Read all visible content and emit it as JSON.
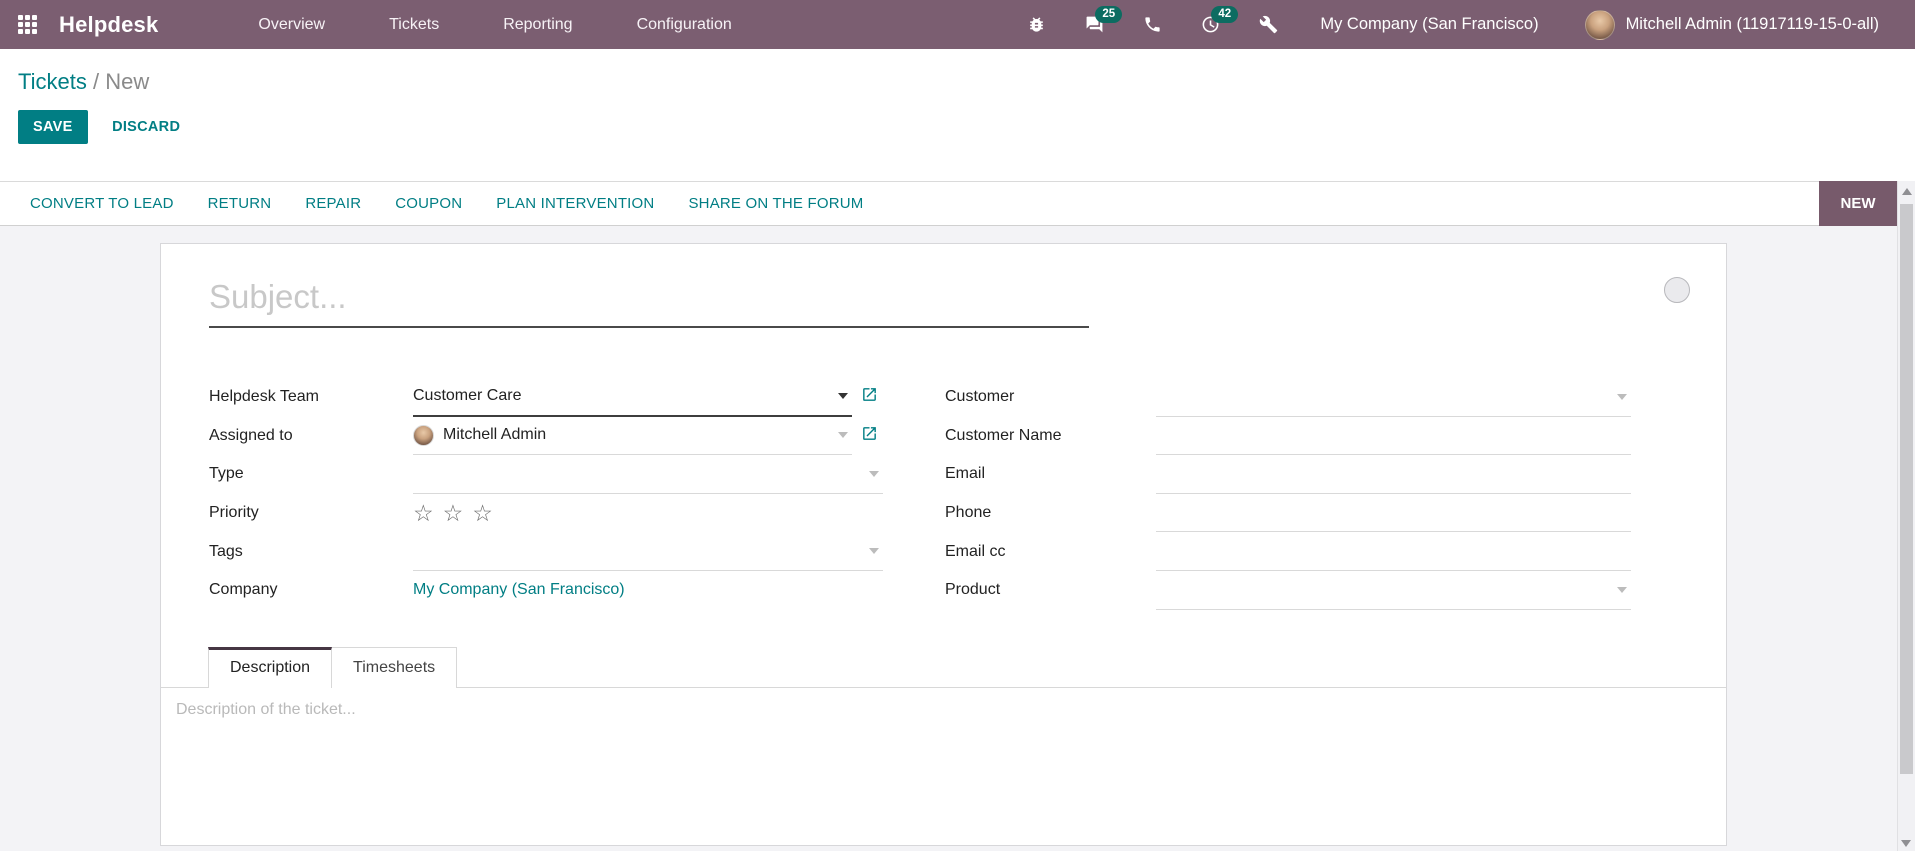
{
  "colors": {
    "topbar_bg": "#7b5e71",
    "accent": "#017e84",
    "badge_bg": "#0c6c61",
    "stage_bg": "#775a6b"
  },
  "topbar": {
    "brand": "Helpdesk",
    "menu": [
      "Overview",
      "Tickets",
      "Reporting",
      "Configuration"
    ],
    "messages_badge": "25",
    "activities_badge": "42",
    "company": "My Company (San Francisco)",
    "user": "Mitchell Admin (11917119-15-0-all)"
  },
  "breadcrumb": {
    "parent": "Tickets",
    "separator": "/",
    "current": "New"
  },
  "control": {
    "save": "SAVE",
    "discard": "DISCARD"
  },
  "statusbar": {
    "buttons": [
      "CONVERT TO LEAD",
      "RETURN",
      "REPAIR",
      "COUPON",
      "PLAN INTERVENTION",
      "SHARE ON THE FORUM"
    ],
    "stage": "NEW"
  },
  "form": {
    "subject_placeholder": "Subject...",
    "helpdesk_team": {
      "label": "Helpdesk Team",
      "value": "Customer Care"
    },
    "assigned_to": {
      "label": "Assigned to",
      "value": "Mitchell Admin"
    },
    "type": {
      "label": "Type"
    },
    "priority": {
      "label": "Priority",
      "star": "☆"
    },
    "tags": {
      "label": "Tags"
    },
    "company": {
      "label": "Company",
      "value": "My Company (San Francisco)"
    },
    "customer": {
      "label": "Customer"
    },
    "customer_name": {
      "label": "Customer Name"
    },
    "email": {
      "label": "Email"
    },
    "phone": {
      "label": "Phone"
    },
    "email_cc": {
      "label": "Email cc"
    },
    "product": {
      "label": "Product"
    },
    "tabs": {
      "description": "Description",
      "timesheets": "Timesheets"
    },
    "description_placeholder": "Description of the ticket..."
  }
}
